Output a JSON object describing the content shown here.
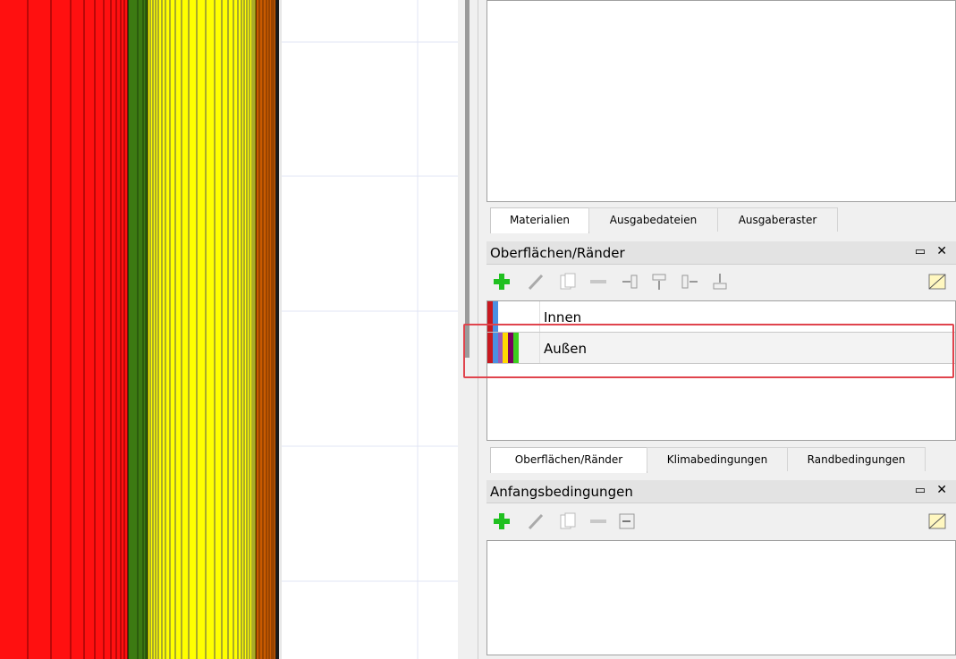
{
  "tabs_top": [
    "Materialien",
    "Ausgabedateien",
    "Ausgaberaster"
  ],
  "surfaces_panel": {
    "title": "Oberflächen/Ränder",
    "items": [
      {
        "name": "Innen",
        "swatches": [
          "#c8181f",
          "#4a90e2"
        ]
      },
      {
        "name": "Außen",
        "swatches": [
          "#c8181f",
          "#4a90e2",
          "#9b59b6",
          "#ffd800",
          "#7a0060",
          "#3ccf1f"
        ]
      }
    ],
    "selected_index": 1
  },
  "tabs_bottom": [
    "Oberflächen/Ränder",
    "Klimabedingungen",
    "Randbedingungen"
  ],
  "initial_panel": {
    "title": "Anfangsbedingungen"
  },
  "icons": {
    "float": "float-window-icon",
    "close": "close-icon",
    "add": "add-plus-icon",
    "edit": "pencil-icon",
    "copy": "copy-document-icon",
    "remove": "minus-icon",
    "toggle": "toggle-view-icon"
  },
  "colors": {
    "layer_red": "#ff1010",
    "layer_green": "#3c7a12",
    "layer_yellow": "#ffff00",
    "layer_orange": "#c85a00",
    "highlight": "#e0444d",
    "add_green": "#20c020"
  }
}
